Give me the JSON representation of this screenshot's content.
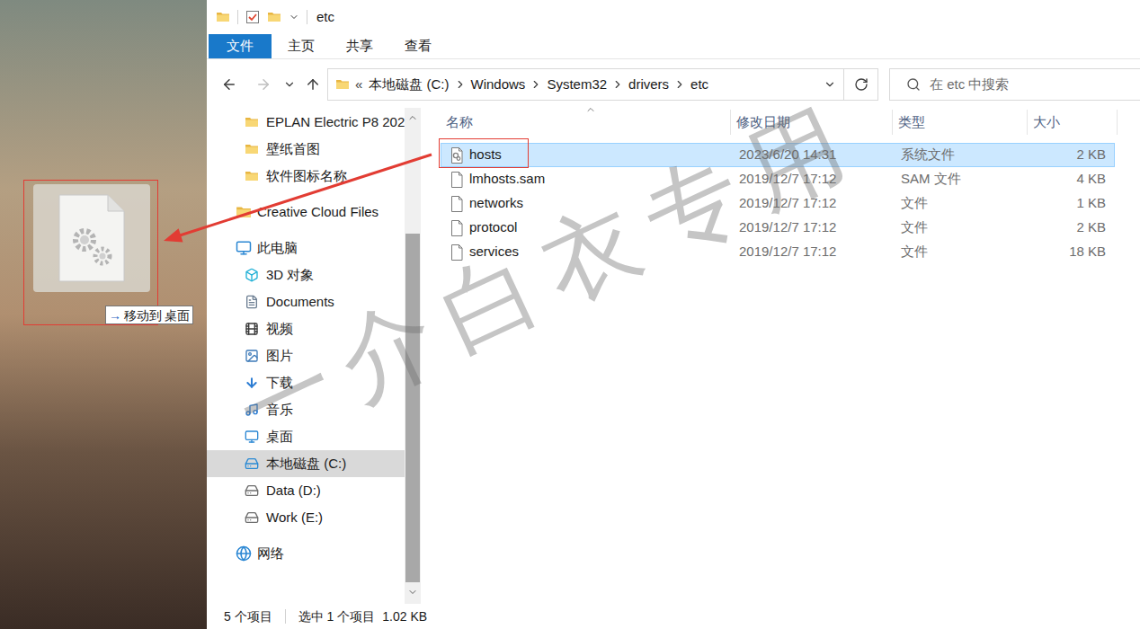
{
  "window": {
    "title": "etc"
  },
  "ribbon": {
    "file_button": "文件",
    "tabs": [
      "主页",
      "共享",
      "查看"
    ]
  },
  "nav_buttons": [
    {
      "kind": "back",
      "disabled": false
    },
    {
      "kind": "forward",
      "disabled": true
    },
    {
      "kind": "recent",
      "disabled": false
    },
    {
      "kind": "up",
      "disabled": false
    }
  ],
  "address_bar": {
    "overflow": "«",
    "crumbs": [
      "本地磁盘 (C:)",
      "Windows",
      "System32",
      "drivers",
      "etc"
    ]
  },
  "search": {
    "placeholder": "在 etc 中搜索"
  },
  "sidebar": {
    "items": [
      {
        "label": "EPLAN Electric P8 202",
        "kind": "folder",
        "selected": false
      },
      {
        "label": "壁纸首图",
        "kind": "folder",
        "selected": false
      },
      {
        "label": "软件图标名称",
        "kind": "folder",
        "selected": false
      },
      {
        "label": "Creative Cloud Files",
        "kind": "cloud",
        "selected": false
      },
      {
        "label": "此电脑",
        "kind": "pc",
        "selected": false
      },
      {
        "label": "3D 对象",
        "kind": "objects3d",
        "selected": false
      },
      {
        "label": "Documents",
        "kind": "documents",
        "selected": false
      },
      {
        "label": "视频",
        "kind": "videos",
        "selected": false
      },
      {
        "label": "图片",
        "kind": "pictures",
        "selected": false
      },
      {
        "label": "下载",
        "kind": "downloads",
        "selected": false
      },
      {
        "label": "音乐",
        "kind": "music",
        "selected": false
      },
      {
        "label": "桌面",
        "kind": "desktop",
        "selected": false
      },
      {
        "label": "本地磁盘 (C:)",
        "kind": "systemdrive",
        "selected": true
      },
      {
        "label": "Data (D:)",
        "kind": "drive",
        "selected": false
      },
      {
        "label": "Work (E:)",
        "kind": "drive",
        "selected": false
      },
      {
        "label": "网络",
        "kind": "network",
        "selected": false
      }
    ]
  },
  "table": {
    "columns": [
      {
        "label": "名称",
        "sorted": true
      },
      {
        "label": "修改日期",
        "sorted": false
      },
      {
        "label": "类型",
        "sorted": false
      },
      {
        "label": "大小",
        "sorted": false
      }
    ],
    "rows": [
      {
        "name": "hosts",
        "date": "2023/6/20 14:31",
        "type": "系统文件",
        "size": "2 KB",
        "kind": "system",
        "selected": true,
        "annotated": true
      },
      {
        "name": "lmhosts.sam",
        "date": "2019/12/7 17:12",
        "type": "SAM 文件",
        "size": "4 KB",
        "kind": "file",
        "selected": false,
        "annotated": false
      },
      {
        "name": "networks",
        "date": "2019/12/7 17:12",
        "type": "文件",
        "size": "1 KB",
        "kind": "file",
        "selected": false,
        "annotated": false
      },
      {
        "name": "protocol",
        "date": "2019/12/7 17:12",
        "type": "文件",
        "size": "2 KB",
        "kind": "file",
        "selected": false,
        "annotated": false
      },
      {
        "name": "services",
        "date": "2019/12/7 17:12",
        "type": "文件",
        "size": "18 KB",
        "kind": "file",
        "selected": false,
        "annotated": false
      }
    ]
  },
  "status_bar": {
    "count": "5 个项目",
    "selection": "选中 1 个项目",
    "selection_size": "1.02 KB"
  },
  "drag": {
    "annotated": true,
    "tooltip": {
      "arrow": "→",
      "action": "移动到",
      "target": "桌面"
    }
  },
  "watermark": "一介白衣专用"
}
